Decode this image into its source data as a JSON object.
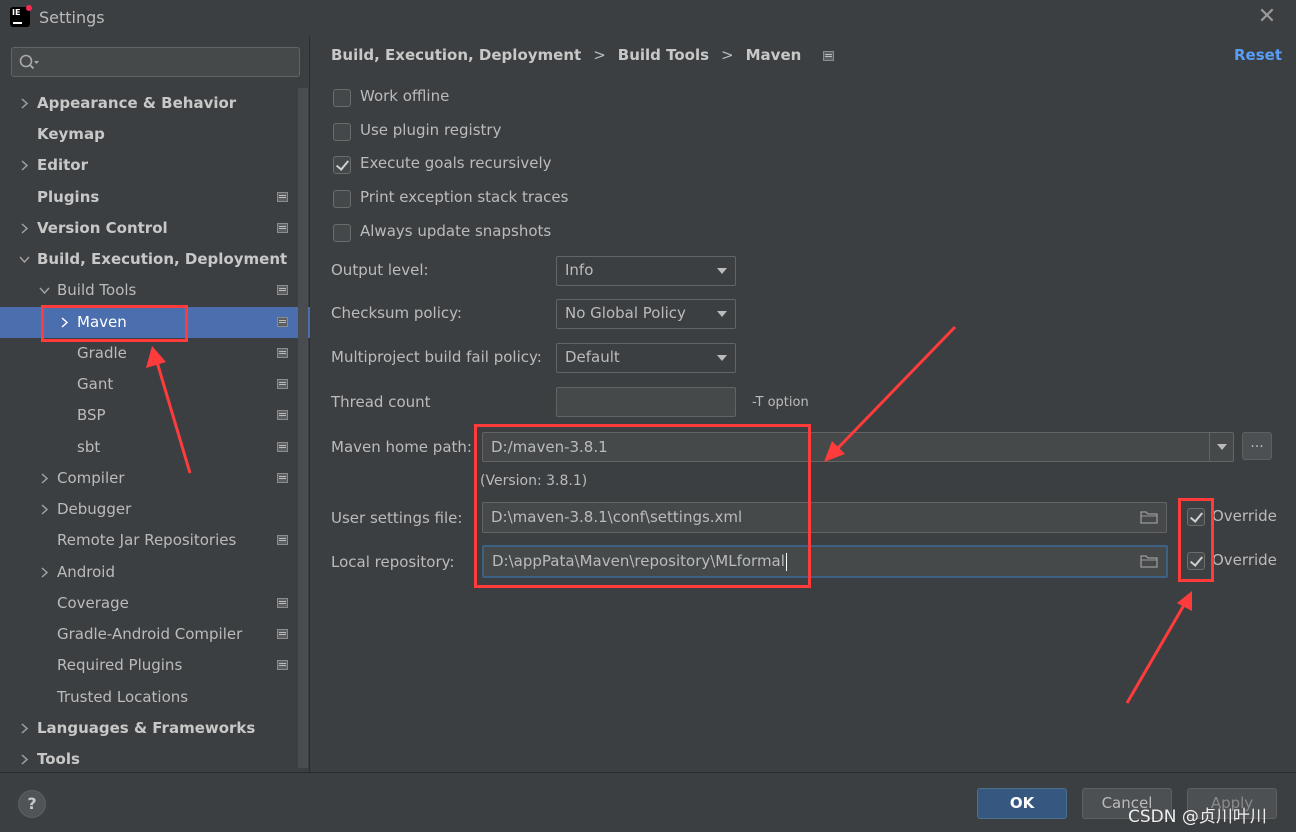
{
  "window": {
    "title": "Settings",
    "logo_text": "IE"
  },
  "search": {
    "placeholder": "",
    "value": ""
  },
  "sidebar": {
    "items": [
      {
        "label": "Appearance & Behavior"
      },
      {
        "label": "Keymap"
      },
      {
        "label": "Editor"
      },
      {
        "label": "Plugins"
      },
      {
        "label": "Version Control"
      },
      {
        "label": "Build, Execution, Deployment"
      },
      {
        "label": "Build Tools"
      },
      {
        "label": "Maven"
      },
      {
        "label": "Gradle"
      },
      {
        "label": "Gant"
      },
      {
        "label": "BSP"
      },
      {
        "label": "sbt"
      },
      {
        "label": "Compiler"
      },
      {
        "label": "Debugger"
      },
      {
        "label": "Remote Jar Repositories"
      },
      {
        "label": "Android"
      },
      {
        "label": "Coverage"
      },
      {
        "label": "Gradle-Android Compiler"
      },
      {
        "label": "Required Plugins"
      },
      {
        "label": "Trusted Locations"
      },
      {
        "label": "Languages & Frameworks"
      },
      {
        "label": "Tools"
      }
    ]
  },
  "breadcrumb": {
    "items": [
      "Build, Execution, Deployment",
      "Build Tools",
      "Maven"
    ],
    "separator": ">"
  },
  "reset_label": "Reset",
  "checkboxes": [
    {
      "label": "Work offline",
      "checked": false
    },
    {
      "label": "Use plugin registry",
      "checked": false
    },
    {
      "label": "Execute goals recursively",
      "checked": true
    },
    {
      "label": "Print exception stack traces",
      "checked": false
    },
    {
      "label": "Always update snapshots",
      "checked": false
    }
  ],
  "form": {
    "output_level": {
      "label": "Output level:",
      "value": "Info"
    },
    "checksum_policy": {
      "label": "Checksum policy:",
      "value": "No Global Policy"
    },
    "multiproject_fail_policy": {
      "label": "Multiproject build fail policy:",
      "value": "Default"
    },
    "thread_count": {
      "label": "Thread count",
      "value": "",
      "hint": "-T option"
    },
    "maven_home": {
      "label": "Maven home path:",
      "value": "D:/maven-3.8.1",
      "version": "(Version: 3.8.1)",
      "browse_label": "..."
    },
    "user_settings": {
      "label": "User settings file:",
      "value": "D:\\maven-3.8.1\\conf\\settings.xml",
      "override_label": "Override",
      "override_checked": true
    },
    "local_repo": {
      "label": "Local repository:",
      "value": "D:\\appPata\\Maven\\repository\\MLformal",
      "override_label": "Override",
      "override_checked": true
    }
  },
  "footer": {
    "help_label": "?",
    "ok_label": "OK",
    "cancel_label": "Cancel",
    "apply_label": "Apply",
    "watermark": "CSDN @贞川叶川"
  },
  "colors": {
    "annotation": "#ff3b3b",
    "selection": "#4b6eaf",
    "link": "#589df6",
    "ok_button": "#365880"
  }
}
